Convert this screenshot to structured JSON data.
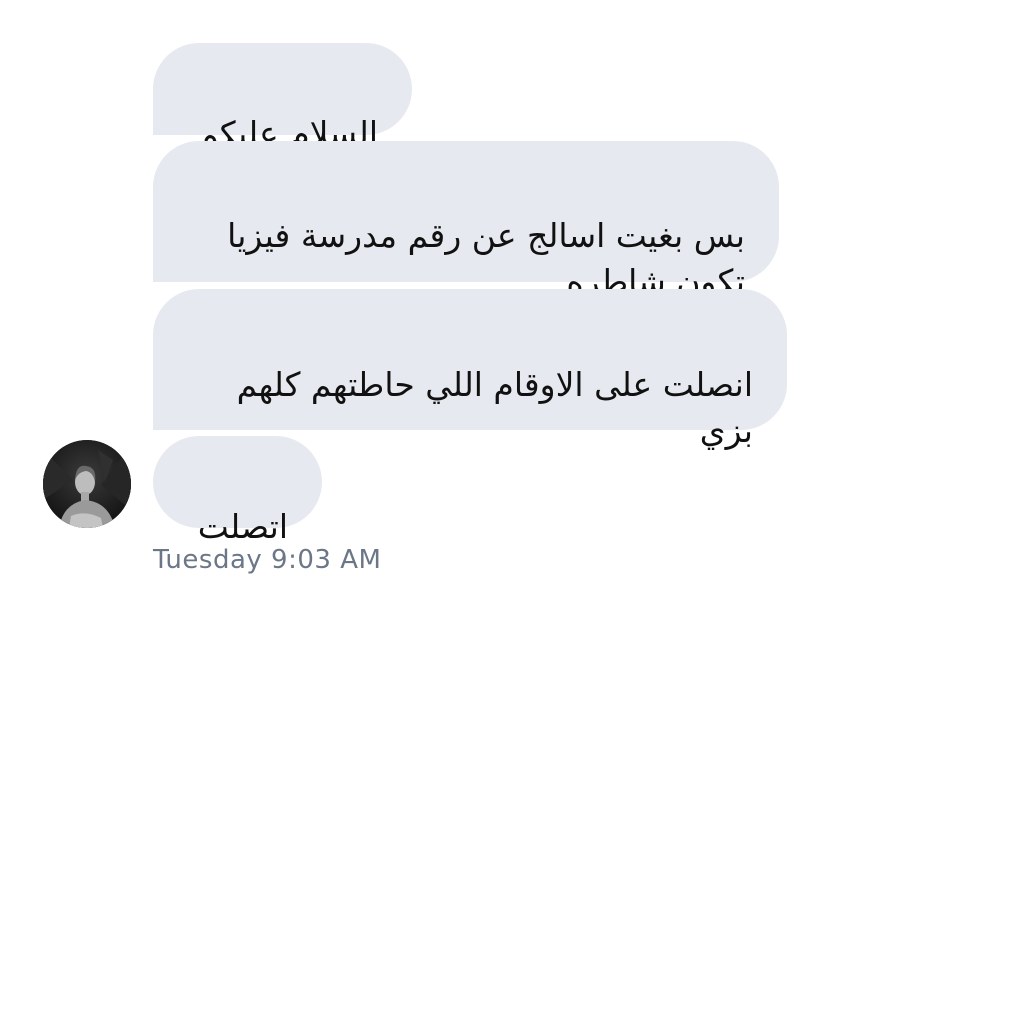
{
  "messages": [
    {
      "text": "السلام عليكم"
    },
    {
      "text": "بس بغيت اسالج عن رقم مدرسة فيزيا\nتكون شاطره"
    },
    {
      "text": "انصلت على الاوقام اللي حاطتهم كلهم\nبزي"
    },
    {
      "text": "اتصلت"
    }
  ],
  "sender": {
    "avatar_icon": "user-avatar-photo"
  },
  "timestamp": "Tuesday 9:03 AM",
  "colors": {
    "bubble": "#e6e9ef",
    "text": "#111111",
    "timestamp": "#6b7787",
    "background": "#ffffff"
  }
}
